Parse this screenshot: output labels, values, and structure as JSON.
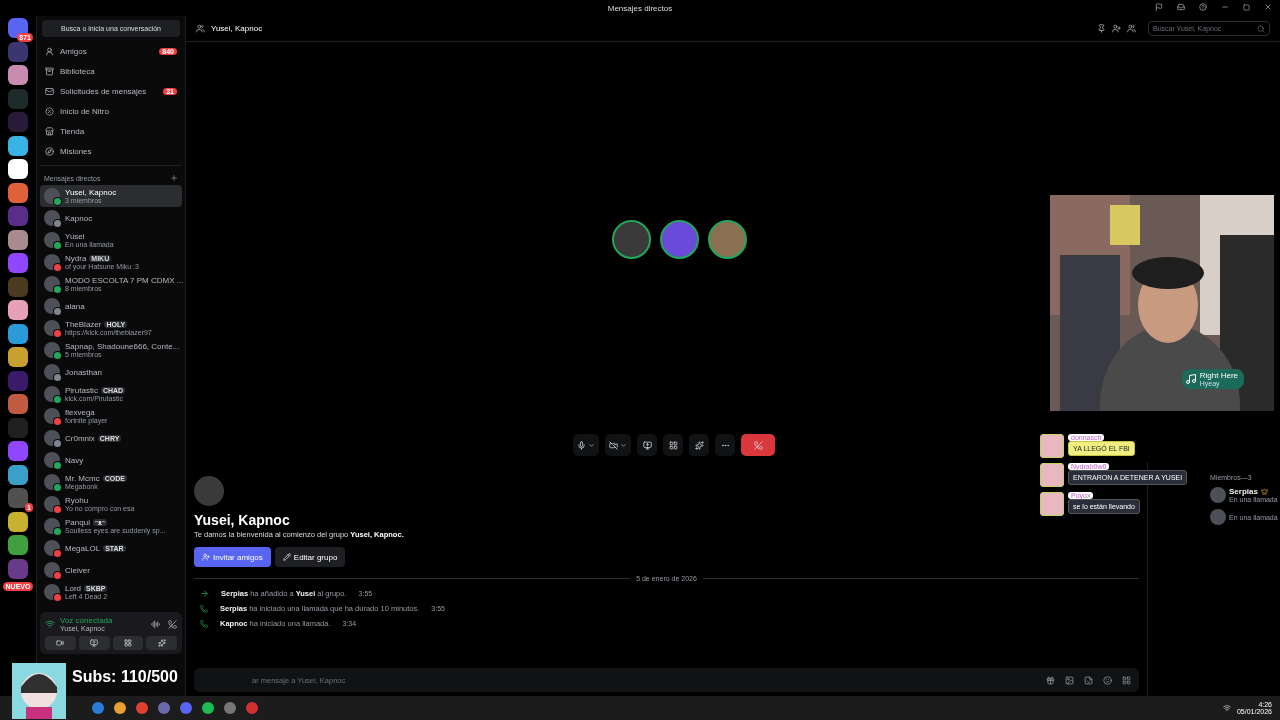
{
  "window": {
    "title": "Mensajes directos"
  },
  "servers": [
    {
      "color": "#5865f2",
      "badge": "871"
    },
    {
      "color": "#3b3570"
    },
    {
      "color": "#c98bb0"
    },
    {
      "color": "#1c2a2a"
    },
    {
      "color": "#2a1a3a"
    },
    {
      "color": "#39b3e6"
    },
    {
      "color": "#ffffff"
    },
    {
      "color": "#e0603a"
    },
    {
      "color": "#5a2d8a"
    },
    {
      "color": "#a88a90"
    },
    {
      "color": "#9147ff"
    },
    {
      "color": "#4a3a20"
    },
    {
      "color": "#e8a0b8"
    },
    {
      "color": "#2a9ad8"
    },
    {
      "color": "#c8a030"
    },
    {
      "color": "#3a1a6a"
    },
    {
      "color": "#c05a40"
    },
    {
      "color": "#202020"
    },
    {
      "color": "#9147ff"
    },
    {
      "color": "#3aa0c8"
    },
    {
      "color": "#505050",
      "badge": "1"
    },
    {
      "color": "#c8b030"
    },
    {
      "color": "#40a040"
    },
    {
      "color": "#6a3a8a"
    }
  ],
  "new_label": "NUEVO",
  "search_button": "Busca o inicia una conversación",
  "nav": [
    {
      "label": "Amigos",
      "badge": "840"
    },
    {
      "label": "Biblioteca"
    },
    {
      "label": "Solicitudes de mensajes",
      "badge": "31"
    },
    {
      "label": "Inicio de Nitro"
    },
    {
      "label": "Tienda"
    },
    {
      "label": "Misiones"
    }
  ],
  "dm_header": "Mensajes directos",
  "dms": [
    {
      "name": "Yusei, Kapnoc",
      "subtitle": "3 miembros",
      "selected": true,
      "color": "#23a55a"
    },
    {
      "name": "Kapnoc",
      "selected": false,
      "color": "#80848e"
    },
    {
      "name": "Yusei",
      "subtitle": "En una llamada",
      "selected": false,
      "color": "#23a55a"
    },
    {
      "name": "Nydra",
      "tag": "MIKU",
      "subtitle": "of your Hatsune Miku :3",
      "selected": false,
      "color": "#f23f43"
    },
    {
      "name": "MODO ESCOLTA 7 PM CDMX ...",
      "subtitle": "8 miembros",
      "selected": false,
      "color": "#23a55a"
    },
    {
      "name": "alana",
      "selected": false,
      "color": "#80848e"
    },
    {
      "name": "TheBlazer",
      "tag": "HOLY",
      "subtitle": "https://kick.com/theblazer97",
      "selected": false,
      "color": "#f23f43"
    },
    {
      "name": "Sapnap, Shadoune666, Conte...",
      "subtitle": "5 miembros",
      "selected": false,
      "color": "#23a55a"
    },
    {
      "name": "Jonasthan",
      "selected": false,
      "color": "#80848e"
    },
    {
      "name": "Pirutastic",
      "tag": "CHAD",
      "subtitle": "kick.com/Pirutastic",
      "selected": false,
      "color": "#23a55a"
    },
    {
      "name": "flexvega",
      "subtitle": "fortnite player",
      "selected": false,
      "color": "#f23f43"
    },
    {
      "name": "Cr0mnix",
      "tag": "CHRY",
      "selected": false,
      "color": "#80848e"
    },
    {
      "name": "Navy",
      "selected": false,
      "color": "#23a55a"
    },
    {
      "name": "Mr. Mcmc",
      "tag": "CODE",
      "subtitle": "Megabonk",
      "selected": false,
      "color": "#23a55a"
    },
    {
      "name": "Ryohu",
      "subtitle": "Yo no compro con esa",
      "selected": false,
      "color": "#f23f43"
    },
    {
      "name": "Panqui",
      "tag": "ᵔᴥᵔ",
      "subtitle": "Soulless eyes are suddenly sp...",
      "selected": false,
      "color": "#23a55a"
    },
    {
      "name": "MegaLOL",
      "tag": "STAR",
      "selected": false,
      "color": "#f23f43"
    },
    {
      "name": "Cleiver",
      "selected": false,
      "color": "#f23f43"
    },
    {
      "name": "Lord",
      "tag": "SKBP",
      "subtitle": "Left 4 Dead 2",
      "selected": false,
      "color": "#f23f43"
    }
  ],
  "voice": {
    "status": "Voz conectada",
    "channel": "Yusei, Kapnoc"
  },
  "header": {
    "title": "Yusei, Kapnoc",
    "search_placeholder": "Buscar Yusei, Kapnoc"
  },
  "call": {
    "participants": [
      {
        "color": "#3a3a3a"
      },
      {
        "color": "#6a4ad8"
      },
      {
        "color": "#8a7050"
      }
    ],
    "mic_muted": false,
    "camera_off": true
  },
  "chat": {
    "title": "Yusei, Kapnoc",
    "welcome": "Te damos la bienvenida al comienzo del grupo **Yusei, Kapnoc.**",
    "buttons": [
      {
        "label": "Invitar amigos",
        "kind": "primary"
      },
      {
        "label": "Editar grupo",
        "kind": "secondary"
      }
    ],
    "date": "5 de enero de 2026",
    "events": [
      {
        "kind": "join",
        "text": "**Serpias** ha añadido a **Yusei** al grupo.",
        "time": "3:55"
      },
      {
        "kind": "call",
        "text": "**Serpias** ha iniciado una llamada que ha durado 10 minutos.",
        "time": "3:55"
      },
      {
        "kind": "call",
        "text": "**Kapnoc** ha iniciado una llamada.",
        "time": "3:34"
      }
    ],
    "input_placeholder": "ar mensaje a Yusei, Kapnoc"
  },
  "members": {
    "header": "Miembros—3",
    "list": [
      {
        "name": "Serpias",
        "activity": "En una llamada",
        "owner": true
      },
      {
        "activity": "En una llamada",
        "owner": false
      }
    ]
  },
  "stream_overlay": {
    "subs": "Subs: 110/500",
    "song": {
      "title": "Right Here",
      "artist": "Hyeay"
    },
    "chat": [
      {
        "user": "donnasch",
        "text": "YA LLEGÓ EL FBI",
        "kind": "highlight"
      },
      {
        "user": "Nydrah0w0",
        "text": "ENTRARON A DETENER A YUSEI",
        "kind": "normal"
      },
      {
        "user": "Puyox",
        "text": "se lo están llevando",
        "kind": "normal"
      }
    ]
  },
  "taskbar": {
    "time": "4:26",
    "date": "05/01/2026"
  }
}
